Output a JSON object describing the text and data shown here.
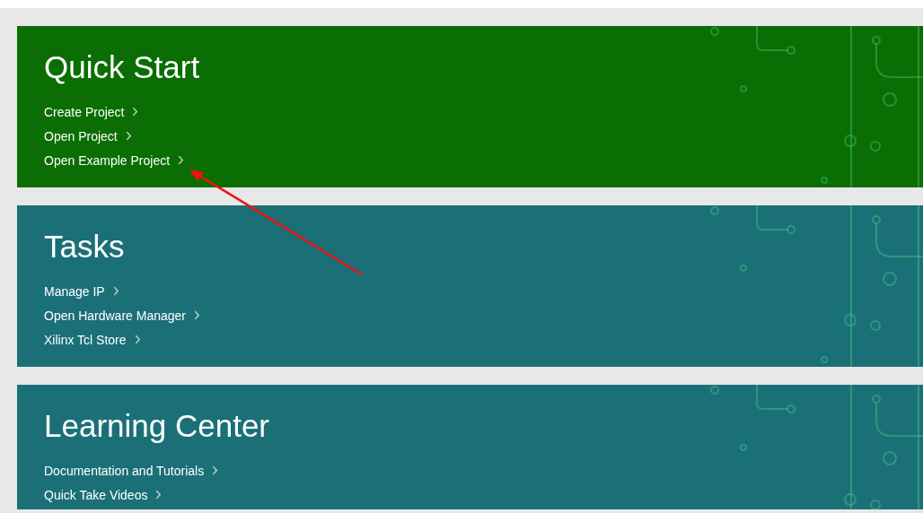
{
  "panels": [
    {
      "title": "Quick Start",
      "color": "#0b6e05",
      "links": [
        "Create Project",
        "Open Project",
        "Open Example Project"
      ]
    },
    {
      "title": "Tasks",
      "color": "#1b7078",
      "links": [
        "Manage IP",
        "Open Hardware Manager",
        "Xilinx Tcl Store"
      ]
    },
    {
      "title": "Learning Center",
      "color": "#1b7078",
      "links": [
        "Documentation and Tutorials",
        "Quick Take Videos"
      ]
    }
  ]
}
